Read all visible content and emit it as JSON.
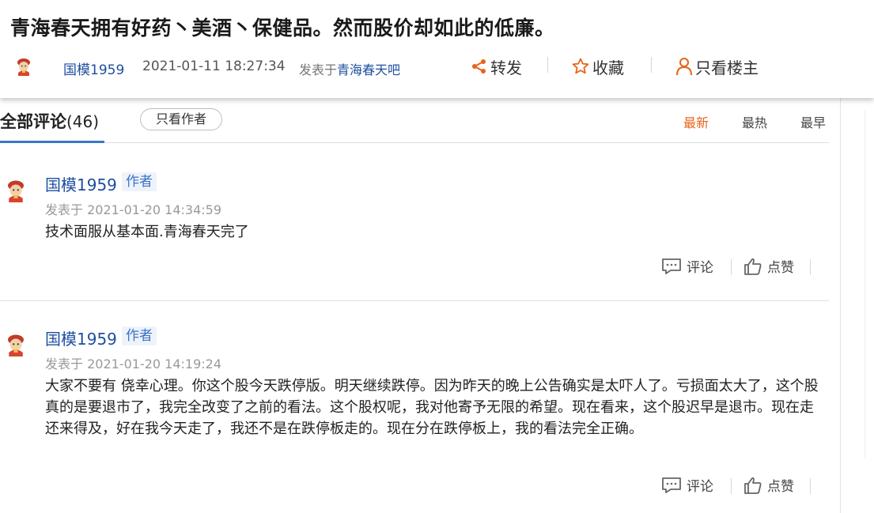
{
  "post": {
    "title": "青海春天拥有好药丶美酒丶保健品。然而股价却如此的低廉。",
    "author": "国模1959",
    "datetime": "2021-01-11 18:27:34",
    "posted_in_prefix": "发表于",
    "bar_name": "青海春天吧",
    "actions": {
      "share": "转发",
      "favorite": "收藏",
      "owner_only": "只看楼主"
    }
  },
  "comments_header": {
    "all_label": "全部评论",
    "count": "(46)",
    "author_only": "只看作者",
    "sort": {
      "newest": "最新",
      "hottest": "最热",
      "earliest": "最早"
    }
  },
  "comments": [
    {
      "author": "国模1959",
      "tag": "作者",
      "date": "发表于 2021-01-20 14:34:59",
      "body": "技术面服从基本面.青海春天完了",
      "comment_label": "评论",
      "like_label": "点赞"
    },
    {
      "author": "国模1959",
      "tag": "作者",
      "date": "发表于 2021-01-20 14:19:24",
      "body": "大家不要有 侥幸心理。你这个股今天跌停版。明天继续跌停。因为昨天的晚上公告确实是太吓人了。亏损面太大了，这个股真的是要退市了，我完全改变了之前的看法。这个股权呢，我对他寄予无限的希望。现在看来，这个股迟早是退市。现在走还来得及，好在我今天走了，我还不是在跌停板走的。现在分在跌停板上，我的看法完全正确。",
      "comment_label": "评论",
      "like_label": "点赞"
    }
  ],
  "colors": {
    "link_blue": "#1f4fa0",
    "accent_orange": "#e8631a",
    "tab_underline": "#3a78c9"
  },
  "icons": [
    "avatar",
    "share-icon",
    "star-icon",
    "person-icon",
    "comment-icon",
    "thumbs-up-icon"
  ]
}
